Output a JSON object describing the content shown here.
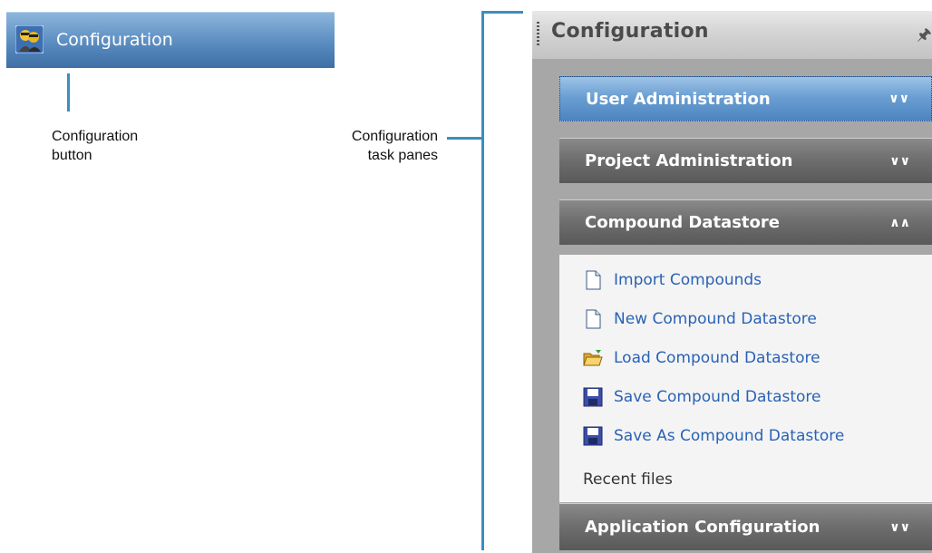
{
  "config_button": {
    "label": "Configuration",
    "icon": "configuration-people-icon"
  },
  "callouts": {
    "button_label_1": "Configuration",
    "button_label_2": "button",
    "panes_label_1": "Configuration",
    "panes_label_2": "task panes"
  },
  "panel": {
    "title": "Configuration",
    "pin_icon": "pin-icon",
    "sections": [
      {
        "label": "User Administration",
        "state": "collapsed",
        "active": true
      },
      {
        "label": "Project Administration",
        "state": "collapsed"
      },
      {
        "label": "Compound Datastore",
        "state": "expanded"
      },
      {
        "label": "Application Configuration",
        "state": "collapsed"
      }
    ],
    "compound_tasks": [
      {
        "label": "Import Compounds",
        "icon": "document-icon"
      },
      {
        "label": "New Compound Datastore",
        "icon": "document-icon"
      },
      {
        "label": "Load Compound Datastore",
        "icon": "open-folder-icon"
      },
      {
        "label": "Save Compound Datastore",
        "icon": "floppy-disk-icon"
      },
      {
        "label": "Save As Compound Datastore",
        "icon": "floppy-disk-icon"
      }
    ],
    "recent_files": "Recent files"
  },
  "colors": {
    "accent_line": "#3a8fbf",
    "link": "#2a62b5",
    "button_blue": "#4f82b8"
  }
}
